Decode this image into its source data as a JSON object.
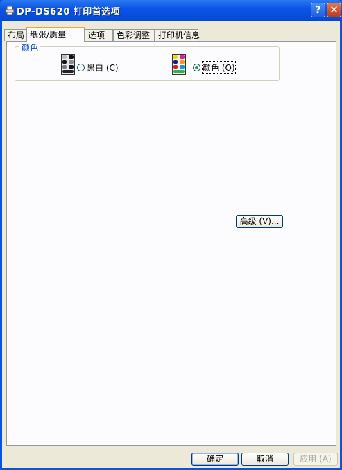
{
  "window": {
    "title": "DP-DS620 打印首选项",
    "help_label": "?",
    "close_label": "✕"
  },
  "tabs": [
    "布局",
    "纸张/质量",
    "选项",
    "色彩调整",
    "打印机信息"
  ],
  "active_tab": "纸张/质量",
  "color_group": {
    "legend": "颜色",
    "options": [
      {
        "label": "黑白 (C)",
        "selected": false,
        "icon": "monochrome-printer-icon"
      },
      {
        "label": "颜色 (O)",
        "selected": true,
        "icon": "color-printer-icon"
      }
    ]
  },
  "advanced_button": "高级 (V)...",
  "footer": {
    "ok": "确定",
    "cancel": "取消",
    "apply": "应用 (A)"
  },
  "colors": {
    "titlebar": "#0b55e6",
    "accent_tab": "#f1a83a",
    "legend_text": "#0046d5"
  }
}
